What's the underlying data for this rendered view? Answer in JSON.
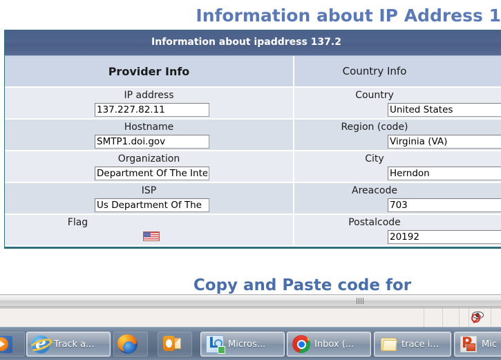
{
  "page": {
    "title": "Information about IP Address 1",
    "subheading": "Copy and Paste code for"
  },
  "table": {
    "header": "Information about ipaddress 137.2",
    "columns": [
      {
        "title": "Provider Info",
        "fields": [
          {
            "label": "IP address",
            "value": "137.227.82.11"
          },
          {
            "label": "Hostname",
            "value": "SMTP1.doi.gov"
          },
          {
            "label": "Organization",
            "value": "Department Of The Inte"
          },
          {
            "label": "ISP",
            "value": "Us Department Of The "
          },
          {
            "label": "Flag",
            "value": "",
            "icon": "us-flag-icon"
          }
        ]
      },
      {
        "title": "Country Info",
        "fields": [
          {
            "label": "Country",
            "value": "United States"
          },
          {
            "label": "Region (code)",
            "value": "Virginia (VA)"
          },
          {
            "label": "City",
            "value": "Herndon"
          },
          {
            "label": "Areacode",
            "value": "703"
          },
          {
            "label": "Postalcode",
            "value": "20192"
          }
        ]
      }
    ]
  },
  "taskbar": {
    "items": [
      {
        "name": "media-player",
        "icon": "media-player-icon",
        "label": "",
        "state": "pinned"
      },
      {
        "name": "internet-explorer",
        "icon": "internet-explorer-icon",
        "label": "Track a...",
        "state": "active"
      },
      {
        "name": "firefox",
        "icon": "firefox-icon",
        "label": "",
        "state": "pinned"
      },
      {
        "name": "outlook",
        "icon": "outlook-icon",
        "label": "",
        "state": "pinned"
      },
      {
        "name": "lync",
        "icon": "lync-icon",
        "label": "Micros...",
        "state": "active"
      },
      {
        "name": "chrome",
        "icon": "chrome-icon",
        "label": "Inbox (...",
        "state": "active"
      },
      {
        "name": "explorer-folder",
        "icon": "folder-icon",
        "label": "trace i...",
        "state": "active"
      },
      {
        "name": "powerpoint",
        "icon": "powerpoint-icon",
        "label": "Mic",
        "state": "active"
      }
    ]
  },
  "colors": {
    "page_title": "#5b7ab5",
    "table_header_bg": "#4b6089",
    "table_border": "#2f6f7a",
    "col_title_bg": "#ccd6e6",
    "row_odd": "#e8ebf1",
    "row_even": "#d9dfe9",
    "taskbar": "#5e7189"
  }
}
